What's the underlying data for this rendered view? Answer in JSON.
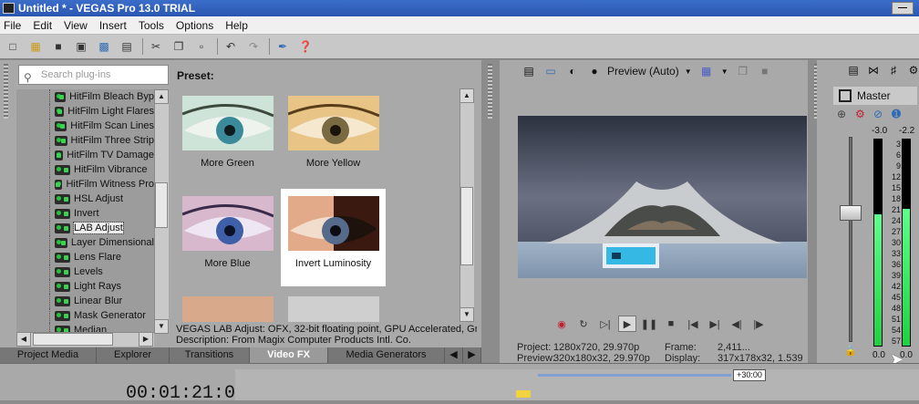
{
  "window": {
    "title": "Untitled * - VEGAS Pro 13.0 TRIAL",
    "minimize": "—"
  },
  "menu": [
    "File",
    "Edit",
    "View",
    "Insert",
    "Tools",
    "Options",
    "Help"
  ],
  "toolbar": {
    "icons": [
      "new-icon",
      "open-icon",
      "save-icon",
      "save-as-icon",
      "render-icon",
      "properties-icon",
      "cut-icon",
      "copy-icon",
      "paste-icon",
      "undo-icon",
      "redo-icon",
      "brush-icon",
      "whats-this-icon"
    ]
  },
  "plugins": {
    "search_placeholder": "Search plug-ins",
    "items": [
      "HitFilm Bleach Byp",
      "HitFilm Light Flares",
      "HitFilm Scan Lines",
      "HitFilm Three Strip",
      "HitFilm TV Damage",
      "HitFilm Vibrance",
      "HitFilm Witness Pro",
      "HSL Adjust",
      "Invert",
      "LAB Adjust",
      "Layer Dimensional",
      "Lens Flare",
      "Levels",
      "Light Rays",
      "Linear Blur",
      "Mask Generator",
      "Median"
    ],
    "selected": "LAB Adjust"
  },
  "presets": {
    "label": "Preset:",
    "items": [
      "More Green",
      "More Yellow",
      "More Blue",
      "Invert Luminosity"
    ],
    "selected": "Invert Luminosity"
  },
  "description": {
    "line1": "VEGAS LAB Adjust: OFX, 32-bit floating point, GPU Accelerated, Gro",
    "line2": "Description: From Magix Computer Products Intl. Co."
  },
  "tabs": [
    "Project Media",
    "Explorer",
    "Transitions",
    "Video FX",
    "Media Generators"
  ],
  "active_tab": "Video FX",
  "preview": {
    "quality": "Preview (Auto)",
    "project_label": "Project:",
    "project_value": "1280x720, 29.970p",
    "preview_label": "Preview:",
    "preview_value": "320x180x32, 29.970p",
    "frame_label": "Frame:",
    "frame_value": "2,411...",
    "display_label": "Display:",
    "display_value": "317x178x32, 1.539"
  },
  "master": {
    "title": "Master",
    "left_peak": "-3.0",
    "right_peak": "-2.2",
    "scale": [
      "3",
      "6",
      "9",
      "12",
      "15",
      "18",
      "21",
      "24",
      "27",
      "30",
      "33",
      "36",
      "39",
      "42",
      "45",
      "48",
      "51",
      "54",
      "57"
    ],
    "left_level": 0.63,
    "right_level": 0.66,
    "left_readout": "0.0",
    "right_readout": "0.0"
  },
  "timeline": {
    "timecode": "00:01:21:07",
    "zoom": "+30:00"
  },
  "colors": {
    "title_bar": "#2a56b0",
    "meter_green": "#1fd142",
    "selection": "#ffffff"
  }
}
